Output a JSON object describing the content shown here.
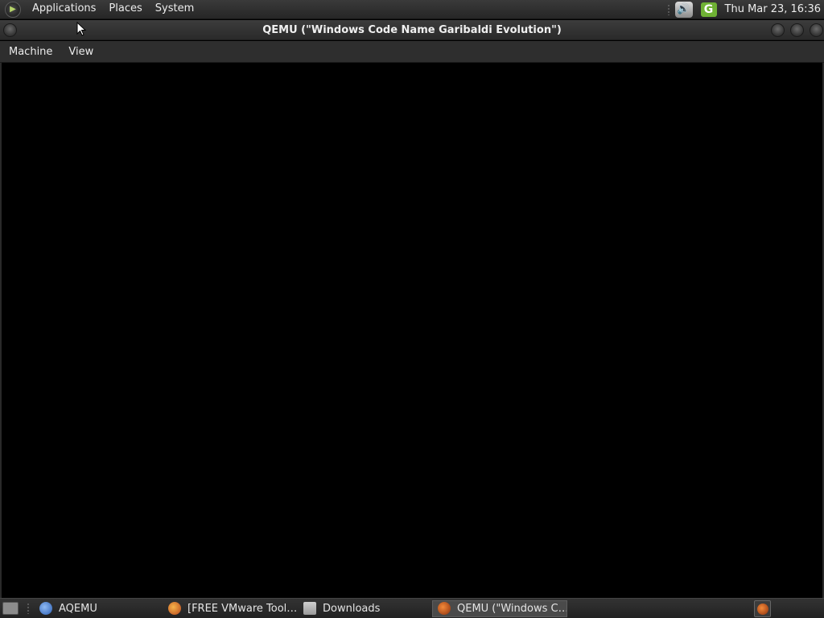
{
  "top_panel": {
    "menus": [
      "Applications",
      "Places",
      "System"
    ],
    "clock": "Thu Mar 23, 16:36",
    "tray_icons": [
      "volume-icon",
      "update-manager-icon"
    ]
  },
  "window": {
    "title": "QEMU (\"Windows Code Name Garibaldi Evolution\")",
    "menu": [
      "Machine",
      "View"
    ]
  },
  "taskbar": {
    "tasks": [
      {
        "label": "AQEMU",
        "icon": "aqemu-icon",
        "active": false
      },
      {
        "label": "[FREE VMware Tool…",
        "icon": "firefox-icon",
        "active": false
      },
      {
        "label": "Downloads",
        "icon": "folder-icon",
        "active": false
      },
      {
        "label": "QEMU (\"Windows C…",
        "icon": "qemu-icon",
        "active": true
      }
    ],
    "tray_icons": [
      "qemu-tray-icon"
    ]
  },
  "colors": {
    "panel": "#2b2b2b",
    "vm_display": "#000000",
    "update_icon": "#6fb234"
  }
}
